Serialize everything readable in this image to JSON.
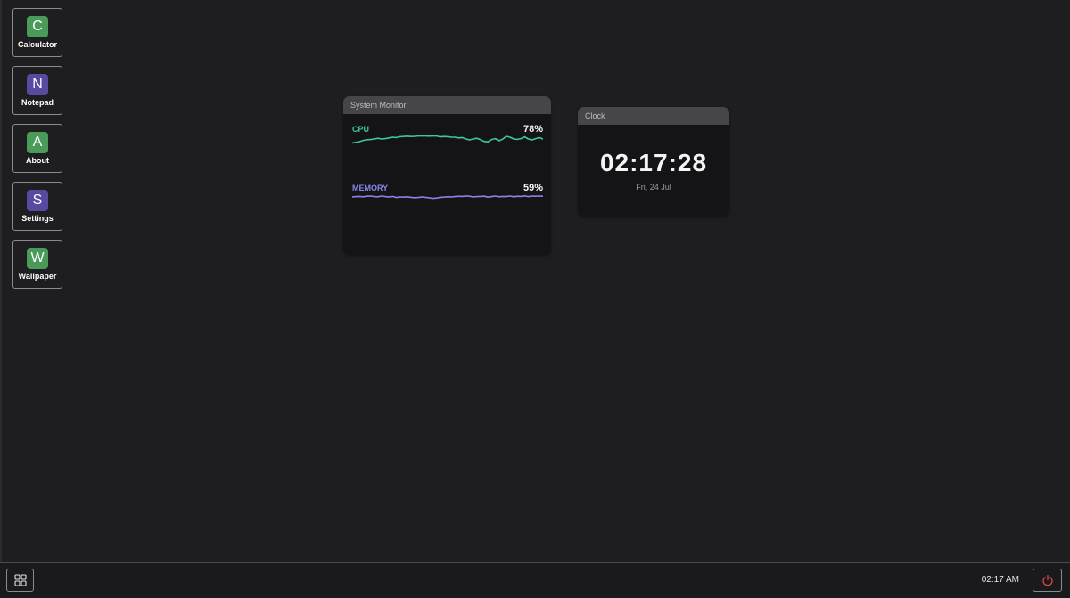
{
  "desktop_icons": [
    {
      "letter": "C",
      "label": "Calculator",
      "color": "#4a9b5a"
    },
    {
      "letter": "N",
      "label": "Notepad",
      "color": "#574aa0"
    },
    {
      "letter": "A",
      "label": "About",
      "color": "#4a9b5a"
    },
    {
      "letter": "S",
      "label": "Settings",
      "color": "#574aa0"
    },
    {
      "letter": "W",
      "label": "Wallpaper",
      "color": "#4a9b5a"
    }
  ],
  "system_monitor": {
    "title": "System Monitor",
    "cpu": {
      "label": "CPU",
      "value": "78%",
      "color": "#3fc79a",
      "history": [
        0.38,
        0.41,
        0.45,
        0.52,
        0.56,
        0.57,
        0.6,
        0.64,
        0.6,
        0.62,
        0.66,
        0.7,
        0.68,
        0.73,
        0.74,
        0.76,
        0.74,
        0.75,
        0.77,
        0.78,
        0.77,
        0.76,
        0.78,
        0.77,
        0.72,
        0.74,
        0.73,
        0.7,
        0.7,
        0.66,
        0.68,
        0.6,
        0.55,
        0.6,
        0.64,
        0.56,
        0.46,
        0.44,
        0.57,
        0.62,
        0.5,
        0.59,
        0.75,
        0.7,
        0.6,
        0.58,
        0.62,
        0.72,
        0.6,
        0.55,
        0.62,
        0.68,
        0.6
      ]
    },
    "memory": {
      "label": "MEMORY",
      "value": "59%",
      "color": "#8b84e8",
      "history": [
        0.55,
        0.57,
        0.58,
        0.56,
        0.59,
        0.6,
        0.57,
        0.56,
        0.6,
        0.57,
        0.55,
        0.58,
        0.52,
        0.55,
        0.54,
        0.56,
        0.53,
        0.51,
        0.52,
        0.55,
        0.53,
        0.5,
        0.47,
        0.49,
        0.53,
        0.54,
        0.56,
        0.55,
        0.57,
        0.59,
        0.58,
        0.6,
        0.59,
        0.55,
        0.57,
        0.58,
        0.59,
        0.54,
        0.57,
        0.6,
        0.56,
        0.58,
        0.57,
        0.6,
        0.56,
        0.59,
        0.58,
        0.61,
        0.57,
        0.6,
        0.59,
        0.6,
        0.59
      ]
    }
  },
  "clock_widget": {
    "title": "Clock",
    "time": "02:17:28",
    "date": "Fri, 24 Jul"
  },
  "taskbar": {
    "start_icon": "grid-icon",
    "time": "02:17 AM",
    "power_icon": "power-icon",
    "power_color": "#e04848"
  }
}
